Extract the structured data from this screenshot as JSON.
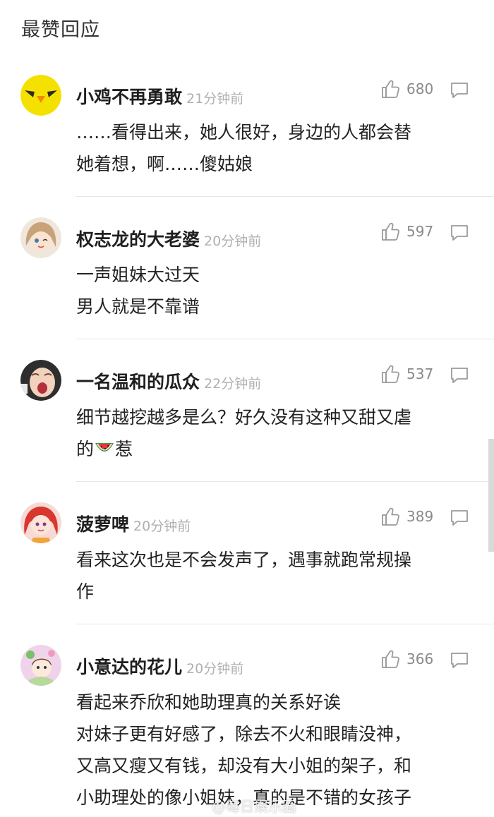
{
  "section_title": "最赞回应",
  "watermark": "@每日娱乐圈",
  "comments": [
    {
      "username": "小鸡不再勇敢",
      "time": "21分钟前",
      "likes": "680",
      "lines": [
        "……看得出来，她人很好，身边的人都会替",
        "她着想，啊……傻姑娘"
      ],
      "avatar_icon": "yellow-chick-avatar-icon",
      "avatar_color": "#f5e100"
    },
    {
      "username": "权志龙的大老婆",
      "time": "20分钟前",
      "likes": "597",
      "lines": [
        "一声姐妹大过天",
        "男人就是不靠谱"
      ],
      "avatar_icon": "anime-girl-avatar-icon",
      "avatar_color": "#c8a37a"
    },
    {
      "username": "一名温和的瓜众",
      "time": "22分钟前",
      "likes": "537",
      "lines": [
        "细节越挖越多是么？好久没有这种又甜又虐",
        "的",
        "惹"
      ],
      "avatar_icon": "crying-baby-avatar-icon",
      "avatar_color": "#3a3a3a"
    },
    {
      "username": "菠萝啤",
      "time": "20分钟前",
      "likes": "389",
      "lines": [
        "看来这次也是不会发声了，遇事就跑常规操",
        "作"
      ],
      "avatar_icon": "red-hair-girl-avatar-icon",
      "avatar_color": "#e0453e"
    },
    {
      "username": "小意达的花儿",
      "time": "20分钟前",
      "likes": "366",
      "lines": [
        "看起来乔欣和她助理真的关系好诶",
        "对妹子更有好感了，除去不火和眼睛没神，",
        "又高又瘦又有钱，却没有大小姐的架子，和",
        "小助理处的像小姐妹，真的是不错的女孩子"
      ],
      "avatar_icon": "flower-girl-avatar-icon",
      "avatar_color": "#e9c6e6"
    }
  ]
}
